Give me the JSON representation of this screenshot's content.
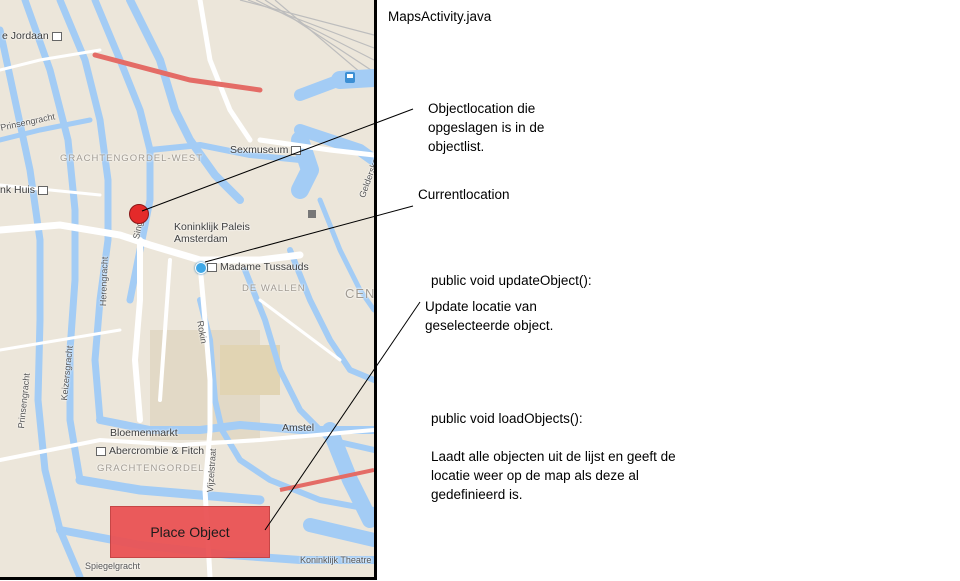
{
  "file_title": "MapsActivity.java",
  "map": {
    "labels": {
      "jordaan": "e Jordaan",
      "prinsengracht_top": "Prinsengracht",
      "grachtengordel_west": "GRACHTENGORDEL-WEST",
      "sexmuseum": "Sexmuseum",
      "anne_frank": "nk Huis",
      "paleis": "Koninklijk Paleis\nAmsterdam",
      "madame": "Madame Tussauds",
      "singel": "Singel",
      "herengracht": "Herengracht",
      "de_wallen": "DE WALLEN",
      "cen": "CEN",
      "rokin": "Rokin",
      "keizersgracht": "Keizersgracht",
      "prinsengracht": "Prinsengracht",
      "bloemenmarkt": "Bloemenmarkt",
      "abercrombie": "Abercrombie & Fitch",
      "grachtengordel": "GRACHTENGORDEL",
      "amstel": "Amstel",
      "vijzelstraat": "Vijzelstraat",
      "spiegelgracht": "Spiegelgracht",
      "koninklijk_theatre": "Koninklijk Theatre",
      "gelderskade": "Gelderskade"
    }
  },
  "buttons": {
    "place_object": "Place Object"
  },
  "annotations": {
    "object_location": "Objectlocation die\nopgeslagen is in de\nobjectlist.",
    "current_location": "Currentlocation",
    "update_method": "public void updateObject():",
    "update_desc": "Update locatie van\ngeselecteerde object.",
    "load_method": "public void loadObjects():",
    "load_desc": "Laadt alle objecten uit de lijst en geeft de\nlocatie weer op de map als deze al\ngedefinieerd is."
  },
  "colors": {
    "marker": "#e42a2a",
    "current_dot": "#3fa7e6",
    "button": "#ea5355",
    "water": "#a3ccf5"
  }
}
